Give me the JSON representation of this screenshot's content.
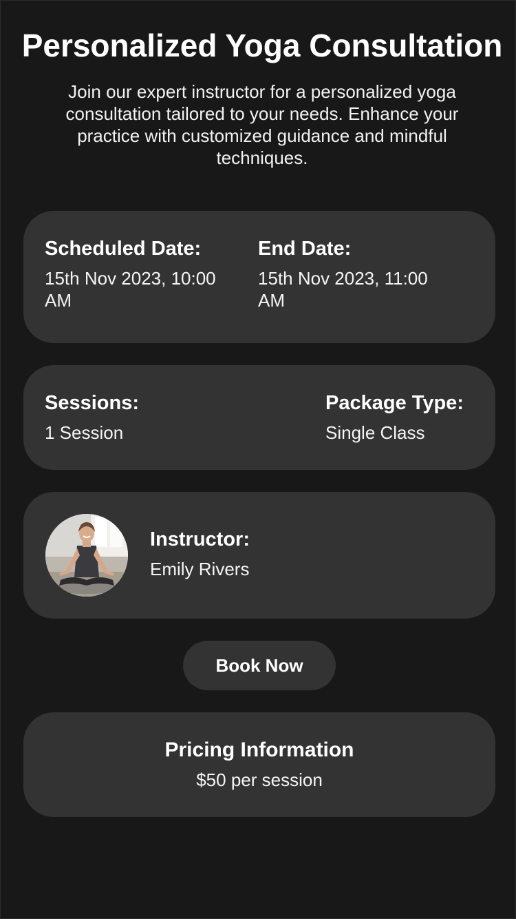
{
  "header": {
    "title": "Personalized Yoga Consultation",
    "description": "Join our expert instructor for a personalized yoga consultation tailored to your needs. Enhance your practice with customized guidance and mindful techniques."
  },
  "schedule": {
    "start_label": "Scheduled Date:",
    "start_value": "15th Nov 2023, 10:00 AM",
    "end_label": "End Date:",
    "end_value": "15th Nov 2023, 11:00 AM"
  },
  "details": {
    "sessions_label": "Sessions:",
    "sessions_value": "1 Session",
    "package_label": "Package Type:",
    "package_value": "Single Class"
  },
  "instructor": {
    "label": "Instructor:",
    "name": "Emily Rivers",
    "avatar_icon": "instructor-photo"
  },
  "actions": {
    "book_label": "Book Now"
  },
  "pricing": {
    "title": "Pricing Information",
    "value": "$50 per session"
  },
  "colors": {
    "background": "#181818",
    "card": "#333333",
    "text": "#ffffff"
  }
}
